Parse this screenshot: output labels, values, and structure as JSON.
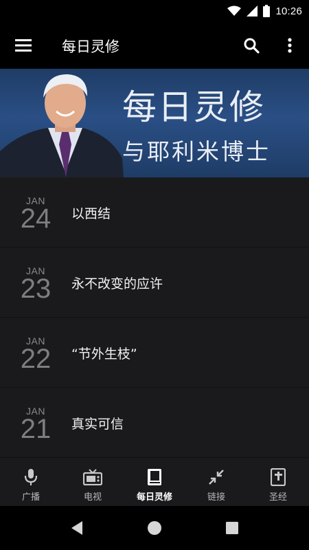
{
  "status_bar": {
    "time": "10:26",
    "icons": [
      "wifi-icon",
      "signal-icon",
      "battery-icon"
    ]
  },
  "app_bar": {
    "title": "每日灵修",
    "icons": [
      "menu-icon",
      "search-icon",
      "more-vert-icon"
    ]
  },
  "banner": {
    "title": "每日灵修",
    "subtitle": "与耶利米博士"
  },
  "devotions": [
    {
      "month": "JAN",
      "day": "24",
      "title": "以西结"
    },
    {
      "month": "JAN",
      "day": "23",
      "title": "永不改变的应许"
    },
    {
      "month": "JAN",
      "day": "22",
      "title": "“节外生枝”"
    },
    {
      "month": "JAN",
      "day": "21",
      "title": "真实可信"
    }
  ],
  "bottom_nav": {
    "tabs": [
      {
        "label": "广播",
        "icon": "microphone-icon"
      },
      {
        "label": "电视",
        "icon": "tv-icon"
      },
      {
        "label": "每日灵修",
        "icon": "book-icon",
        "active": true
      },
      {
        "label": "链接",
        "icon": "connect-icon"
      },
      {
        "label": "圣经",
        "icon": "bible-icon"
      }
    ]
  },
  "system_nav": [
    "back-icon",
    "home-icon",
    "recents-icon"
  ],
  "colors": {
    "background": "#000000",
    "list_background": "#1a1a1c",
    "banner_blue": "#2a4f85",
    "date_gray": "#8b8b8f",
    "active_label": "#ffffff"
  }
}
